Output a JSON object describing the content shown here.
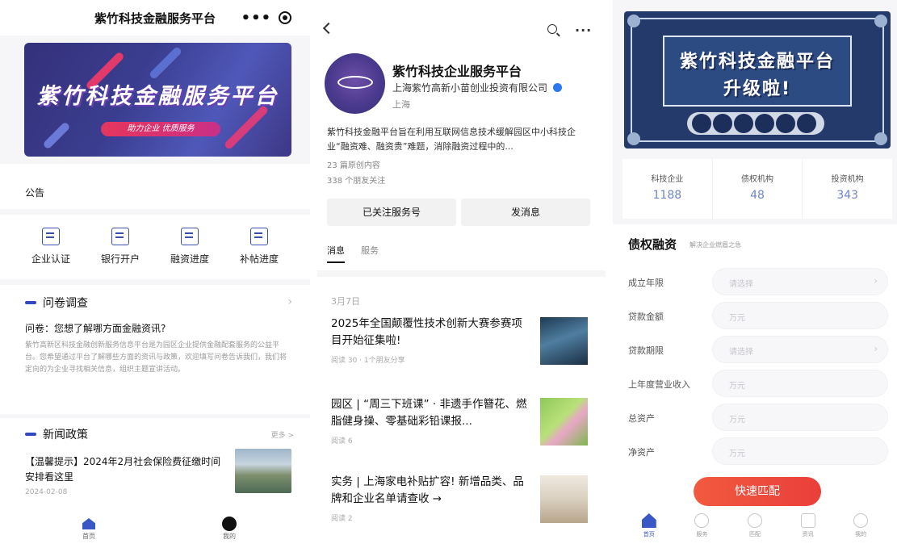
{
  "panel1": {
    "title": "紫竹科技金融服务平台",
    "capsule_dots": "•••",
    "banner": {
      "title": "紫竹科技金融服务平台",
      "subtitle": "助力企业 优质服务"
    },
    "notice_label": "公告",
    "quick_actions": [
      {
        "label": "企业认证",
        "icon": "building-icon"
      },
      {
        "label": "银行开户",
        "icon": "bank-card-icon"
      },
      {
        "label": "融资进度",
        "icon": "document-icon"
      },
      {
        "label": "补帖进度",
        "icon": "form-check-icon"
      }
    ],
    "survey": {
      "heading": "问卷调查",
      "question": "问卷：您想了解哪方面金融资讯?",
      "description": "紫竹高新区科技金融创新服务信息平台是为园区企业提供金融配套服务的公益平台。您希望通过平台了解哪些方面的资讯与政策，欢迎填写问卷告诉我们，我们将定向的为企业寻找相关信息，组织主题宣讲活动。"
    },
    "news": {
      "heading": "新闻政策",
      "more": "更多 >",
      "title": "【温馨提示】2024年2月社会保险费征缴时间安排看这里",
      "date": "2024-02-08"
    },
    "tabbar": [
      {
        "label": "首页"
      },
      {
        "label": "我的"
      }
    ]
  },
  "panel2": {
    "name": "紫竹科技企业服务平台",
    "company": "上海紫竹高新小苗创业投资有限公司",
    "city": "上海",
    "intro": "紫竹科技金融平台旨在利用互联网信息技术缓解园区中小科技企业“融资难、融资贵”难题，消除融资过程中的...",
    "articles_count": "23 篇原创内容",
    "followers": "338 个朋友关注",
    "follow_button": "已关注服务号",
    "message_button": "发消息",
    "tabs": [
      {
        "label": "消息"
      },
      {
        "label": "服务"
      }
    ],
    "feed_date": "3月7日",
    "articles": [
      {
        "title": "2025年全国颠覆性技术创新大赛参赛项目开始征集啦!",
        "meta": "阅读 30 · 1个朋友分享"
      },
      {
        "title": "园区 | “周三下班课” · 非遗手作簪花、燃脂健身操、零基础彩铅课报...",
        "meta": "阅读 6"
      },
      {
        "title": "实务 | 上海家电补贴扩容! 新增品类、品牌和企业名单请查收 →",
        "meta": "阅读 2"
      }
    ]
  },
  "panel3": {
    "banner": {
      "line1": "紫竹科技金融平台",
      "line2": "升级啦!"
    },
    "stats": [
      {
        "label": "科技企业",
        "value": "1188"
      },
      {
        "label": "债权机构",
        "value": "48"
      },
      {
        "label": "投资机构",
        "value": "343"
      }
    ],
    "form": {
      "title": "债权融资",
      "subtitle": "解决企业燃眉之急",
      "fields": [
        {
          "label": "成立年限",
          "placeholder": "请选择",
          "arrow": true
        },
        {
          "label": "贷款金额",
          "placeholder": "万元",
          "arrow": false
        },
        {
          "label": "贷款期限",
          "placeholder": "请选择",
          "arrow": true
        },
        {
          "label": "上年度营业收入",
          "placeholder": "万元",
          "arrow": false
        },
        {
          "label": "总资产",
          "placeholder": "万元",
          "arrow": false
        },
        {
          "label": "净资产",
          "placeholder": "万元",
          "arrow": false
        }
      ],
      "submit": "快速匹配"
    },
    "tabbar": [
      {
        "label": "首页",
        "icon": "home-icon"
      },
      {
        "label": "服务",
        "icon": "heart-icon"
      },
      {
        "label": "匹配",
        "icon": "match-icon"
      },
      {
        "label": "资讯",
        "icon": "news-icon"
      },
      {
        "label": "我的",
        "icon": "user-icon"
      }
    ]
  }
}
